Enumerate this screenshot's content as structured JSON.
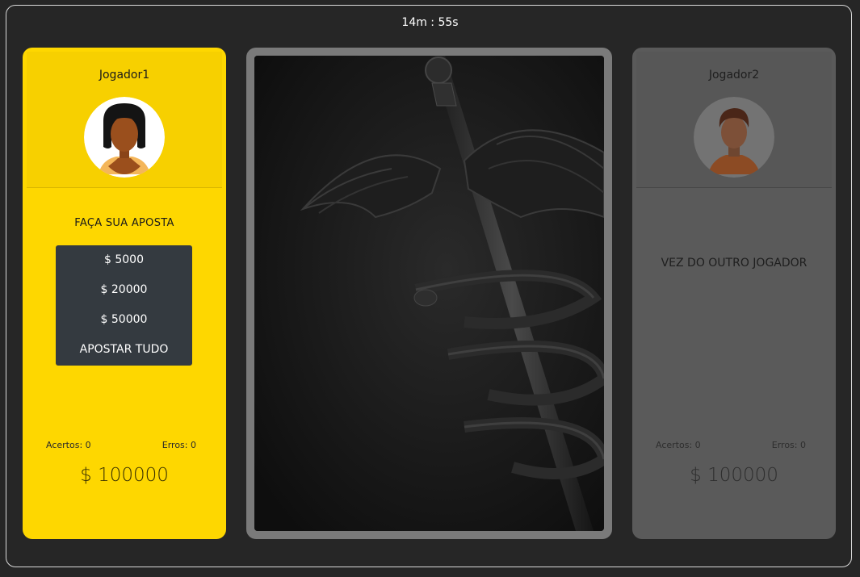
{
  "timer": "14m : 55s",
  "player1": {
    "name": "Jogador1",
    "bet_title": "FAÇA SUA APOSTA",
    "bet_options": [
      "$ 5000",
      "$ 20000",
      "$ 50000",
      "APOSTAR TUDO"
    ],
    "hits": "Acertos: 0",
    "errors": "Erros: 0",
    "money": "$ 100000"
  },
  "player2": {
    "name": "Jogador2",
    "status": "VEZ DO OUTRO JOGADOR",
    "hits": "Acertos: 0",
    "errors": "Erros: 0",
    "money": "$ 100000"
  },
  "card": {
    "icon": "caduceus-icon"
  },
  "colors": {
    "active_panel": "#fed700",
    "inactive_panel": "#5a5a5a",
    "bet_menu": "#343a40",
    "background": "#262626"
  }
}
